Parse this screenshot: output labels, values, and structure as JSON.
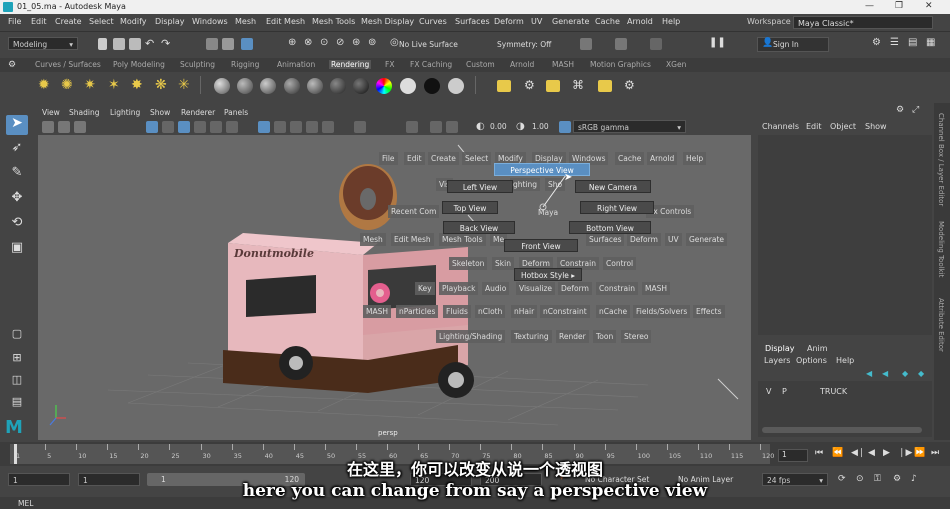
{
  "titlebar": {
    "title": "01_05.ma - Autodesk Maya",
    "app_icon": "maya-logo-icon"
  },
  "menubar": {
    "items": [
      "File",
      "Edit",
      "Create",
      "Select",
      "Modify",
      "Display",
      "Windows",
      "Mesh",
      "Edit Mesh",
      "Mesh Tools",
      "Mesh Display",
      "Curves",
      "Surfaces",
      "Deform",
      "UV",
      "Generate",
      "Cache",
      "Arnold",
      "Help"
    ],
    "workspace_label": "Workspace :",
    "workspace_value": "Maya Classic*"
  },
  "statusline": {
    "menuset": "Modeling",
    "live_surface": "No Live Surface",
    "symmetry": "Symmetry: Off",
    "sign_in": "Sign In"
  },
  "shelf": {
    "tabs": [
      "Curves / Surfaces",
      "Poly Modeling",
      "Sculpting",
      "Rigging",
      "Animation",
      "Rendering",
      "FX",
      "FX Caching",
      "Custom",
      "Arnold",
      "MASH",
      "Motion Graphics",
      "XGen"
    ],
    "active_tab": "Rendering"
  },
  "viewport": {
    "menu": [
      "View",
      "Shading",
      "Lighting",
      "Show",
      "Renderer",
      "Panels"
    ],
    "exposure": "0.00",
    "gamma": "1.00",
    "colorspace": "sRGB gamma",
    "camera_label": "persp",
    "truck_sign": "Donutmobile"
  },
  "hotbox": {
    "top_row": [
      "File",
      "Edit",
      "Create",
      "Select",
      "Modify",
      "Display",
      "Windows",
      "Cache",
      "Arnold",
      "Help"
    ],
    "recent": "Recent Com",
    "hotbox_controls": "ox Controls",
    "vis": "Vis",
    "lighting": "ghting",
    "show": "Sho",
    "center": "Maya",
    "mesh_row": [
      "Mesh",
      "Edit Mesh",
      "Mesh Tools",
      "Me",
      "Surfaces",
      "Deform",
      "UV",
      "Generate"
    ],
    "skeleton_row": [
      "Skeleton",
      "Skin",
      "Deform",
      "Constrain",
      "Control"
    ],
    "hotbox_style": "Hotbox Style",
    "key_row": [
      "Key",
      "Playback",
      "Audio",
      "Visualize",
      "Deform",
      "Constrain",
      "MASH"
    ],
    "mash_row": [
      "MASH",
      "nParticles",
      "Fluids",
      "nCloth",
      "nHair",
      "nConstraint",
      "nCache",
      "Fields/Solvers",
      "Effects"
    ],
    "render_row": [
      "Lighting/Shading",
      "Texturing",
      "Render",
      "Toon",
      "Stereo"
    ],
    "marking_menu": {
      "north": "Perspective View",
      "west": "Left View",
      "east": "New Camera",
      "northwest": "Top View",
      "northeast": "Right View",
      "southwest": "Back View",
      "southeast": "Bottom View",
      "south": "Front View"
    }
  },
  "channelbox": {
    "menu": [
      "Channels",
      "Edit",
      "Object",
      "Show"
    ]
  },
  "sidetabs": [
    "Channel Box / Layer Editor",
    "Modeling Toolkit",
    "Attribute Editor"
  ],
  "layers": {
    "tabs": [
      "Display",
      "Anim"
    ],
    "menu": [
      "Layers",
      "Options",
      "Help"
    ],
    "row": {
      "v": "V",
      "p": "P",
      "name": "TRUCK"
    }
  },
  "timeline": {
    "ticks": [
      "1",
      "5",
      "10",
      "15",
      "20",
      "25",
      "30",
      "35",
      "40",
      "45",
      "50",
      "55",
      "60",
      "65",
      "70",
      "75",
      "80",
      "85",
      "90",
      "95",
      "100",
      "105",
      "110",
      "115",
      "120"
    ],
    "current": "1"
  },
  "range": {
    "start": "1",
    "range_start": "1",
    "range_current": "1",
    "range_end_a": "120",
    "end": "120",
    "end2": "200",
    "character_set": "No Character Set",
    "anim_layer": "No Anim Layer",
    "fps": "24 fps"
  },
  "cmdline": {
    "label": "MEL"
  },
  "subtitles": {
    "chinese": "在这里，你可以改变从说一个透视图",
    "english": "here you can change from say a perspective view"
  }
}
